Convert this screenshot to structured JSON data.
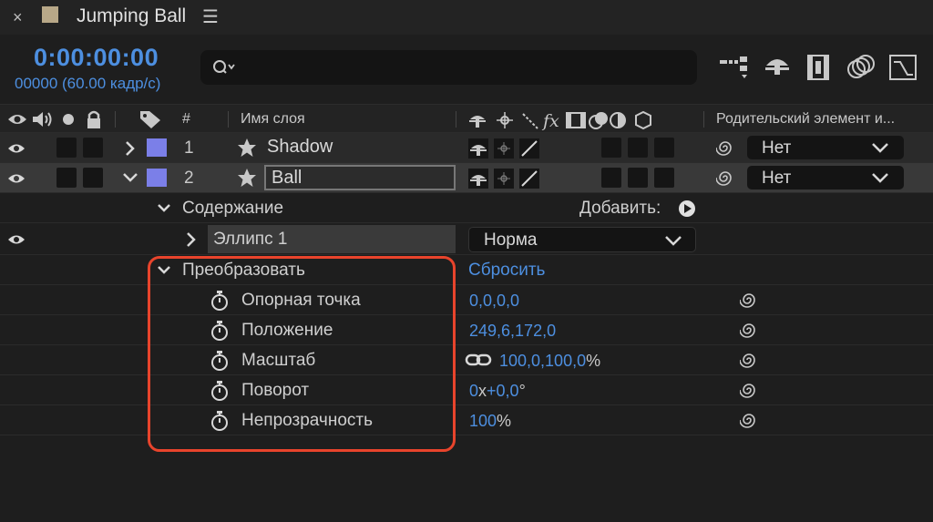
{
  "tab": {
    "title": "Jumping Ball",
    "close_glyph": "×",
    "menu_glyph": "☰",
    "swatch_color": "#b8a888"
  },
  "header": {
    "timecode": "0:00:00:00",
    "frames": "00000 (60.00 кадр/с)",
    "search_placeholder": ""
  },
  "columns": {
    "hash": "#",
    "layer_name": "Имя слоя",
    "parent": "Родительский элемент и..."
  },
  "layers": [
    {
      "number": "1",
      "name": "Shadow",
      "parent": "Нет",
      "expanded": false,
      "selected": false
    },
    {
      "number": "2",
      "name": "Ball",
      "parent": "Нет",
      "expanded": true,
      "selected": true
    }
  ],
  "contents": {
    "label": "Содержание",
    "add_label": "Добавить:"
  },
  "ellipse": {
    "label": "Эллипс 1",
    "blend_mode": "Норма"
  },
  "transform": {
    "label": "Преобразовать",
    "reset_label": "Сбросить",
    "properties": [
      {
        "name": "Опорная точка",
        "value_blue": "0,0,0,0",
        "suffix": ""
      },
      {
        "name": "Положение",
        "value_blue": "249,6,172,0",
        "suffix": ""
      },
      {
        "name": "Масштаб",
        "value_blue": "100,0,100,0",
        "suffix": "%"
      },
      {
        "name": "Поворот",
        "value_blue": "0",
        "mid": "x",
        "value_blue2": "+0,0",
        "suffix": "°"
      },
      {
        "name": "Непрозрачность",
        "value_blue": "100",
        "suffix": "%"
      }
    ]
  },
  "colors": {
    "accent": "#4d8fe0",
    "label_color": "#7b7fe8",
    "highlight": "#e8442c"
  },
  "icons": [
    "close-icon",
    "hamburger-icon",
    "search-icon",
    "eye-icon",
    "stopwatch-icon",
    "spiral-pickwhip-icon",
    "chain-link-icon",
    "star-icon"
  ]
}
